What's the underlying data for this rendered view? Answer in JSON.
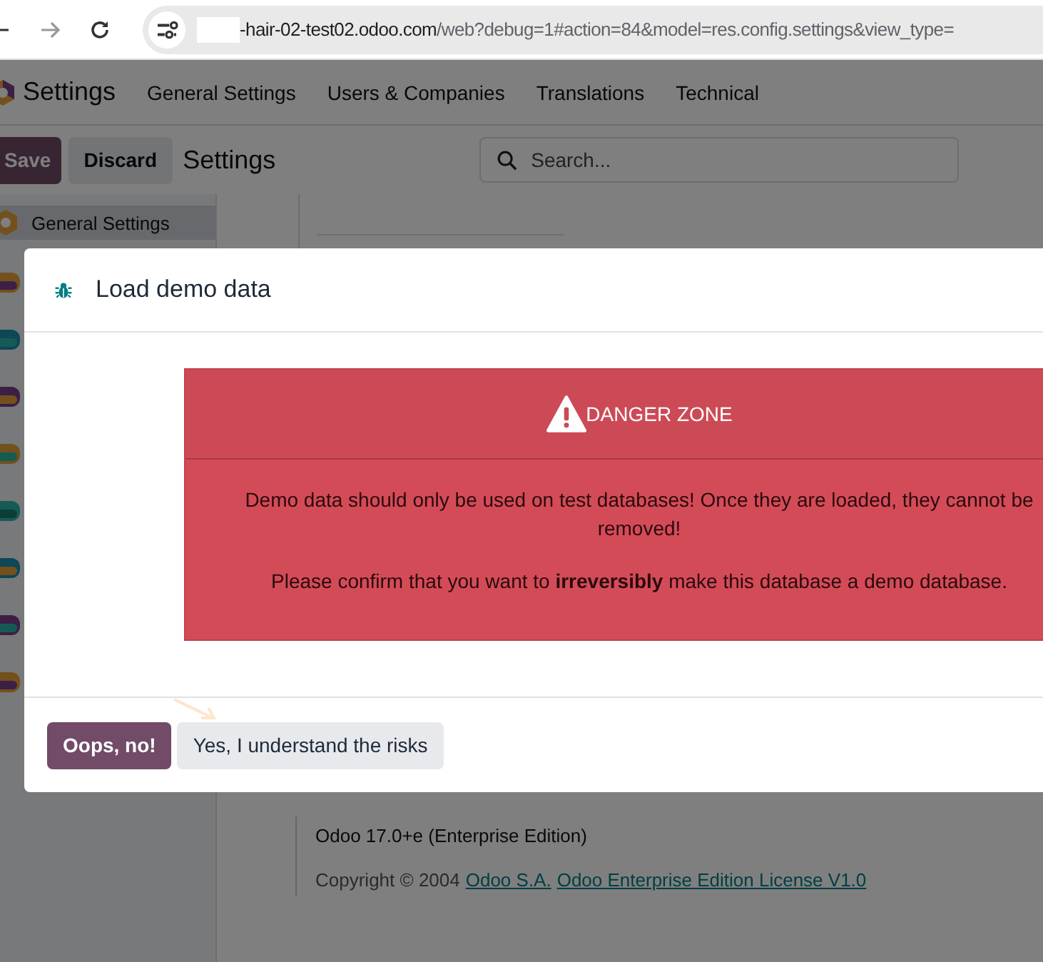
{
  "browser": {
    "url_host": "-hair-02-test02.odoo.com",
    "url_path": "/web?debug=1#action=84&model=res.config.settings&view_type="
  },
  "navbar": {
    "app_name": "Settings",
    "menu": [
      "General Settings",
      "Users & Companies",
      "Translations",
      "Technical"
    ]
  },
  "control_panel": {
    "save": "Save",
    "discard": "Discard",
    "breadcrumb": "Settings",
    "search": {
      "placeholder": "Search..."
    }
  },
  "sidebar": {
    "items": [
      {
        "label": "General Settings",
        "selected": true
      }
    ]
  },
  "about": {
    "version": "Odoo 17.0+e (Enterprise Edition)",
    "copyright": "Copyright © 2004",
    "links": [
      "Odoo S.A.",
      "Odoo Enterprise Edition License V1.0"
    ]
  },
  "dialog": {
    "title": "Load demo data",
    "alert": {
      "title": "DANGER ZONE",
      "message": "Demo data should only be used on test databases! Once they are loaded, they cannot be removed!",
      "confirm": "Please confirm that you want to **irreversibly** make this database a demo database."
    },
    "buttons": [
      {
        "label": "Oops, no!",
        "kind": "primary"
      },
      {
        "label": "Yes, I understand the risks",
        "kind": "secondary"
      }
    ]
  }
}
